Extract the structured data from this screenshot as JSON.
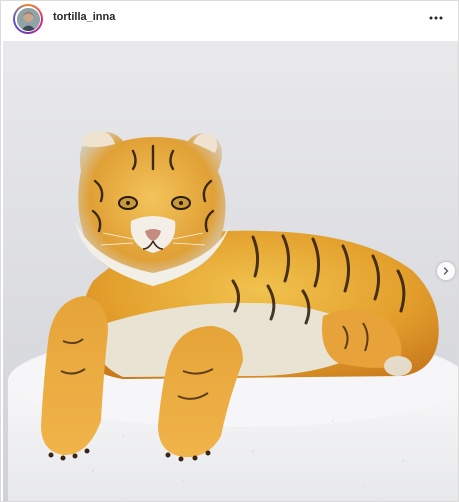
{
  "post": {
    "username": "tortilla_inna",
    "more_icon": "more-horizontal-icon",
    "next_icon": "chevron-right-icon"
  }
}
